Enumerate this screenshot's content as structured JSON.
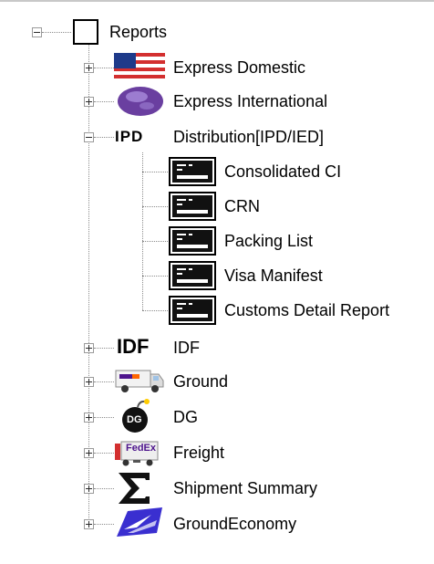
{
  "tree": {
    "root": {
      "label": "Reports",
      "icon": "document-icon",
      "expanded": true
    },
    "items": [
      {
        "label": "Express Domestic",
        "icon": "us-flag-icon",
        "expanded": false
      },
      {
        "label": "Express International",
        "icon": "globe-icon",
        "expanded": false
      },
      {
        "label": "Distribution[IPD/IED]",
        "icon": "ipd-logo-icon",
        "icon_text": "IPD",
        "expanded": true,
        "children": [
          {
            "label": "Consolidated CI",
            "icon": "report-icon"
          },
          {
            "label": "CRN",
            "icon": "report-icon"
          },
          {
            "label": "Packing List",
            "icon": "report-icon"
          },
          {
            "label": "Visa Manifest",
            "icon": "report-icon"
          },
          {
            "label": "Customs Detail Report",
            "icon": "report-icon"
          }
        ]
      },
      {
        "label": "IDF",
        "icon": "idf-logo-icon",
        "icon_text": "IDF",
        "expanded": false
      },
      {
        "label": "Ground",
        "icon": "delivery-truck-icon",
        "expanded": false
      },
      {
        "label": "DG",
        "icon": "bomb-icon",
        "icon_text": "DG",
        "expanded": false
      },
      {
        "label": "Freight",
        "icon": "freight-truck-icon",
        "icon_text": "FedEx",
        "expanded": false
      },
      {
        "label": "Shipment Summary",
        "icon": "sigma-icon",
        "expanded": false
      },
      {
        "label": "GroundEconomy",
        "icon": "usps-eagle-icon",
        "expanded": false
      }
    ]
  },
  "colors": {
    "tree_line": "#8c8c8c",
    "expander_border": "#9a9a9a",
    "flag_red": "#d32f2f",
    "flag_blue": "#1e3a8a",
    "globe_purple": "#6a3fa0",
    "fedex_purple": "#4d148c",
    "fedex_orange": "#ff6600",
    "usps_blue": "#3a2fd0"
  }
}
